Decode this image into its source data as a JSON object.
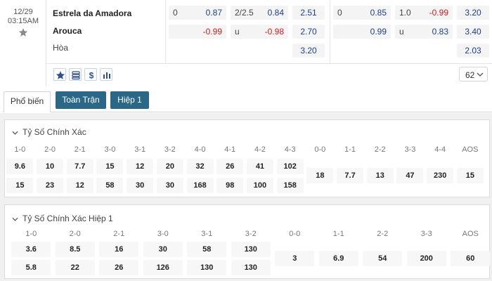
{
  "match": {
    "date": "12/29",
    "time": "03:15AM",
    "home": "Estrela da Amadora",
    "away": "Arouca",
    "draw": "Hòa",
    "odds": {
      "ft_hdp": {
        "line_home": "0",
        "home": "0.87",
        "away": "-0.99"
      },
      "ft_ou": {
        "line": "2/2.5",
        "over": "0.84",
        "under_label": "u",
        "under": "-0.98"
      },
      "ft_1x2": {
        "home": "2.51",
        "away": "2.70",
        "draw": "3.20"
      },
      "h1_hdp": {
        "line_home": "0",
        "home": "0.85",
        "away": "0.99"
      },
      "h1_ou": {
        "line": "1.0",
        "over": "-0.99",
        "under_label": "u",
        "under": "0.83"
      },
      "h1_1x2": {
        "home": "3.20",
        "away": "3.40",
        "draw": "2.03"
      }
    },
    "more_select": "62"
  },
  "icons": [
    "star-icon",
    "layers-icon",
    "dollar-icon",
    "bar-chart-icon"
  ],
  "colors": {
    "blue": "#1d3f8a",
    "red": "#d01b1b",
    "tab_dark": "#2b6787"
  },
  "tabs": [
    {
      "label": "Phổ biến",
      "active": true
    },
    {
      "label": "Toàn Trận",
      "active": false
    },
    {
      "label": "Hiệp 1",
      "active": false
    }
  ],
  "sections": [
    {
      "title": "Tỷ Số Chính Xác",
      "headers": [
        "1-0",
        "2-0",
        "2-1",
        "3-0",
        "3-1",
        "3-2",
        "4-0",
        "4-1",
        "4-2",
        "4-3",
        "0-0",
        "1-1",
        "2-2",
        "3-3",
        "4-4",
        "AOS"
      ],
      "row1": [
        "9.6",
        "10",
        "7.7",
        "15",
        "12",
        "20",
        "32",
        "26",
        "41",
        "102"
      ],
      "row2": [
        "15",
        "23",
        "12",
        "58",
        "30",
        "30",
        "168",
        "98",
        "100",
        "158"
      ],
      "single": [
        "18",
        "7.7",
        "13",
        "47",
        "230",
        "15"
      ]
    },
    {
      "title": "Tỷ Số Chính Xác Hiệp 1",
      "headers": [
        "1-0",
        "2-0",
        "2-1",
        "3-0",
        "3-1",
        "3-2",
        "0-0",
        "1-1",
        "2-2",
        "3-3",
        "AOS"
      ],
      "row1": [
        "3.6",
        "8.5",
        "16",
        "30",
        "58",
        "130"
      ],
      "row2": [
        "5.8",
        "22",
        "26",
        "126",
        "130",
        "130"
      ],
      "single": [
        "3",
        "6.9",
        "54",
        "200",
        "60"
      ]
    }
  ]
}
